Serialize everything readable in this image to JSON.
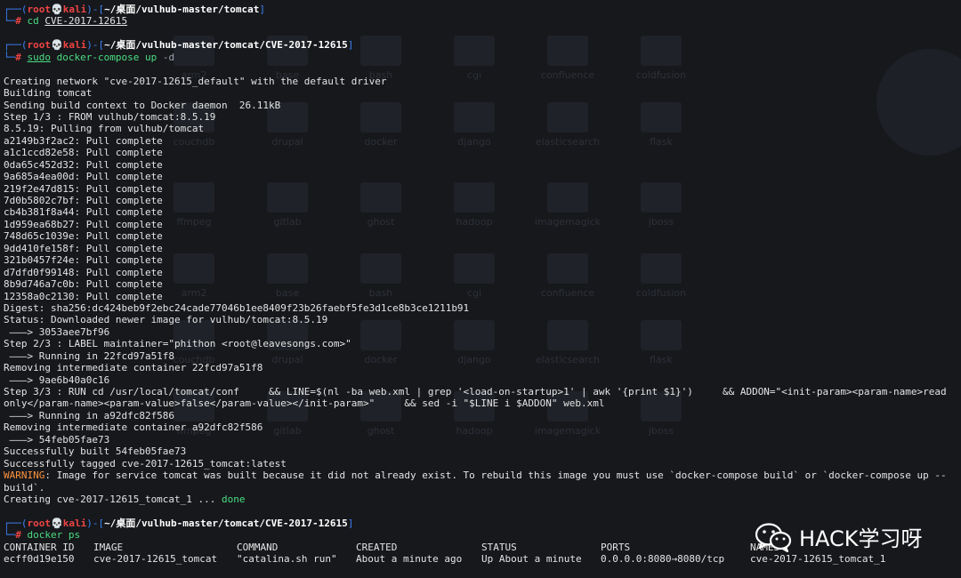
{
  "desktop": {
    "folders": [
      "arm2",
      "base",
      "bash",
      "cgi",
      "confluence",
      "coldfusion",
      "couchdb",
      "drupal",
      "docker",
      "django",
      "elasticsearch",
      "flask",
      "ffmpeg",
      "gitlab",
      "ghost",
      "hadoop",
      "imagemagick",
      "jboss"
    ]
  },
  "terminal": {
    "prompt": {
      "user": "root",
      "skull": "💀",
      "host": "kali",
      "hash": "#"
    },
    "session1": {
      "path": "~/桌面/vulhub-master/tomcat",
      "command": "cd",
      "arg": "CVE-2017-12615"
    },
    "session2": {
      "path": "~/桌面/vulhub-master/tomcat/CVE-2017-12615",
      "command": "sudo",
      "args": "docker-compose up",
      "opt": "-d",
      "output": [
        "Creating network \"cve-2017-12615_default\" with the default driver",
        "Building tomcat",
        "Sending build context to Docker daemon  26.11kB",
        "Step 1/3 : FROM vulhub/tomcat:8.5.19",
        "8.5.19: Pulling from vulhub/tomcat",
        "a2149b3f2ac2: Pull complete",
        "a1c1ccd82e58: Pull complete",
        "0da65c452d32: Pull complete",
        "9a685a4ea00d: Pull complete",
        "219f2e47d815: Pull complete",
        "7d0b5802c7bf: Pull complete",
        "cb4b381f8a44: Pull complete",
        "1d959ea68b27: Pull complete",
        "748d65c1039e: Pull complete",
        "9dd410fe158f: Pull complete",
        "321b0457f24e: Pull complete",
        "d7dfd0f99148: Pull complete",
        "8b9d746a7c0b: Pull complete",
        "12358a0c2130: Pull complete",
        "Digest: sha256:dc424beb9f2ebc24cade77046b1ee8409f23b26faebf5fe3d1ce8b3ce1211b91",
        "Status: Downloaded newer image for vulhub/tomcat:8.5.19",
        " ———> 3053aee7bf96",
        "Step 2/3 : LABEL maintainer=\"phithon <root@leavesongs.com>\"",
        " ———> Running in 22fcd97a51f8",
        "Removing intermediate container 22fcd97a51f8",
        " ———> 9ae6b40a0c16",
        "Step 3/3 : RUN cd /usr/local/tomcat/conf     && LINE=$(nl -ba web.xml | grep '<load-on-startup>1' | awk '{print $1}')     && ADDON=\"<init-param><param-name>read",
        "only</param-name><param-value>false</param-value></init-param>\"     && sed -i \"$LINE i $ADDON\" web.xml",
        " ———> Running in a92dfc82f586",
        "Removing intermediate container a92dfc82f586",
        " ———> 54feb05fae73",
        "Successfully built 54feb05fae73",
        "Successfully tagged cve-2017-12615_tomcat:latest"
      ],
      "warning_label": "WARNING",
      "warning_text": ": Image for service tomcat was built because it did not already exist. To rebuild this image you must use `docker-compose build` or `docker-compose up --",
      "warning_cont": "build`.",
      "creating_text": "Creating cve-2017-12615_tomcat_1 ... ",
      "creating_status": "done"
    },
    "session3": {
      "path": "~/桌面/vulhub-master/tomcat/CVE-2017-12615",
      "command": "docker ps",
      "table": {
        "headers": [
          "CONTAINER ID",
          "IMAGE",
          "COMMAND",
          "CREATED",
          "STATUS",
          "PORTS",
          "NAMES"
        ],
        "rows": [
          [
            "ecff0d19e150",
            "cve-2017-12615_tomcat",
            "\"catalina.sh run\"",
            "About a minute ago",
            "Up About a minute",
            "0.0.0.0:8080→8080/tcp",
            "cve-2017-12615_tomcat_1"
          ]
        ]
      }
    }
  },
  "watermark": {
    "text": "HACK学习呀",
    "icon": "wechat-icon"
  }
}
